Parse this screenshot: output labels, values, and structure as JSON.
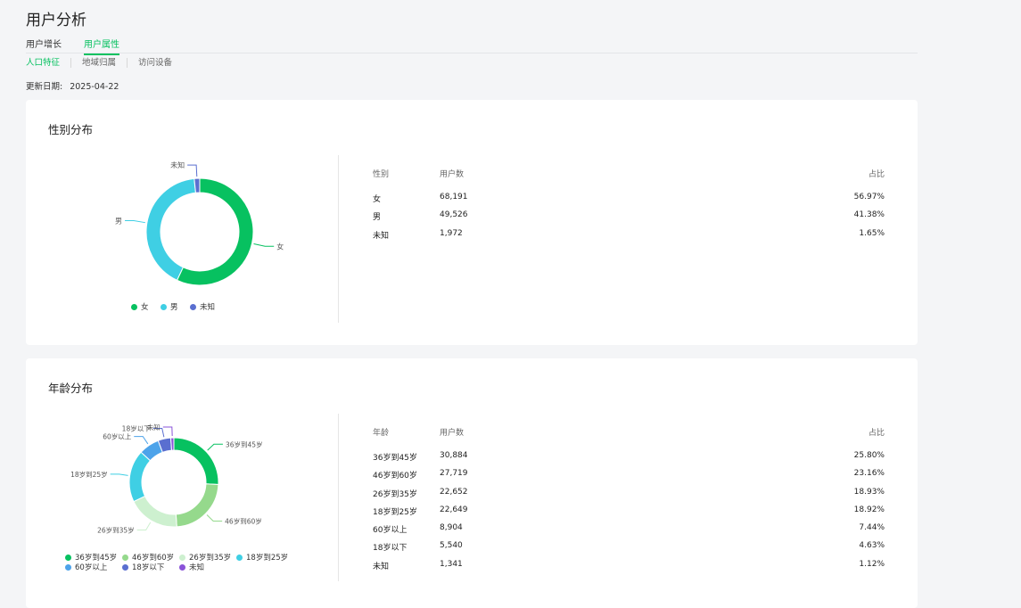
{
  "page_title": "用户分析",
  "tabs": [
    {
      "label": "用户增长",
      "active": false
    },
    {
      "label": "用户属性",
      "active": true
    }
  ],
  "subtabs": [
    {
      "label": "人口特征",
      "active": true
    },
    {
      "label": "地域归属",
      "active": false
    },
    {
      "label": "访问设备",
      "active": false
    }
  ],
  "update": {
    "label": "更新日期:",
    "value": "2025-04-22"
  },
  "colors": {
    "accent": "#07c160"
  },
  "gender": {
    "title": "性别分布",
    "headers": [
      "性别",
      "用户数",
      "占比"
    ],
    "rows": [
      {
        "name": "女",
        "count": "68,191",
        "pct": "56.97%"
      },
      {
        "name": "男",
        "count": "49,526",
        "pct": "41.38%"
      },
      {
        "name": "未知",
        "count": "1,972",
        "pct": "1.65%"
      }
    ],
    "legend": [
      "女",
      "男",
      "未知"
    ]
  },
  "age": {
    "title": "年龄分布",
    "headers": [
      "年龄",
      "用户数",
      "占比"
    ],
    "rows": [
      {
        "name": "36岁到45岁",
        "count": "30,884",
        "pct": "25.80%"
      },
      {
        "name": "46岁到60岁",
        "count": "27,719",
        "pct": "23.16%"
      },
      {
        "name": "26岁到35岁",
        "count": "22,652",
        "pct": "18.93%"
      },
      {
        "name": "18岁到25岁",
        "count": "22,649",
        "pct": "18.92%"
      },
      {
        "name": "60岁以上",
        "count": "8,904",
        "pct": "7.44%"
      },
      {
        "name": "18岁以下",
        "count": "5,540",
        "pct": "4.63%"
      },
      {
        "name": "未知",
        "count": "1,341",
        "pct": "1.12%"
      }
    ],
    "legend": [
      "36岁到45岁",
      "46岁到60岁",
      "26岁到35岁",
      "18岁到25岁",
      "60岁以上",
      "18岁以下",
      "未知"
    ]
  },
  "chart_data": [
    {
      "type": "pie",
      "categories": [
        "女",
        "男",
        "未知"
      ],
      "values": [
        56.97,
        41.38,
        1.65
      ],
      "colors": [
        "#07c160",
        "#3fcfe4",
        "#5a6fd0"
      ],
      "legend": "bottom"
    },
    {
      "type": "pie",
      "categories": [
        "36岁到45岁",
        "46岁到60岁",
        "26岁到35岁",
        "18岁到25岁",
        "60岁以上",
        "18岁以下",
        "未知"
      ],
      "values": [
        25.8,
        23.16,
        18.93,
        18.92,
        7.44,
        4.63,
        1.12
      ],
      "colors": [
        "#07c160",
        "#95d98c",
        "#cdf0cf",
        "#3fcfe4",
        "#4da3ea",
        "#5a6fd0",
        "#8a53d9"
      ],
      "legend": "bottom"
    }
  ]
}
